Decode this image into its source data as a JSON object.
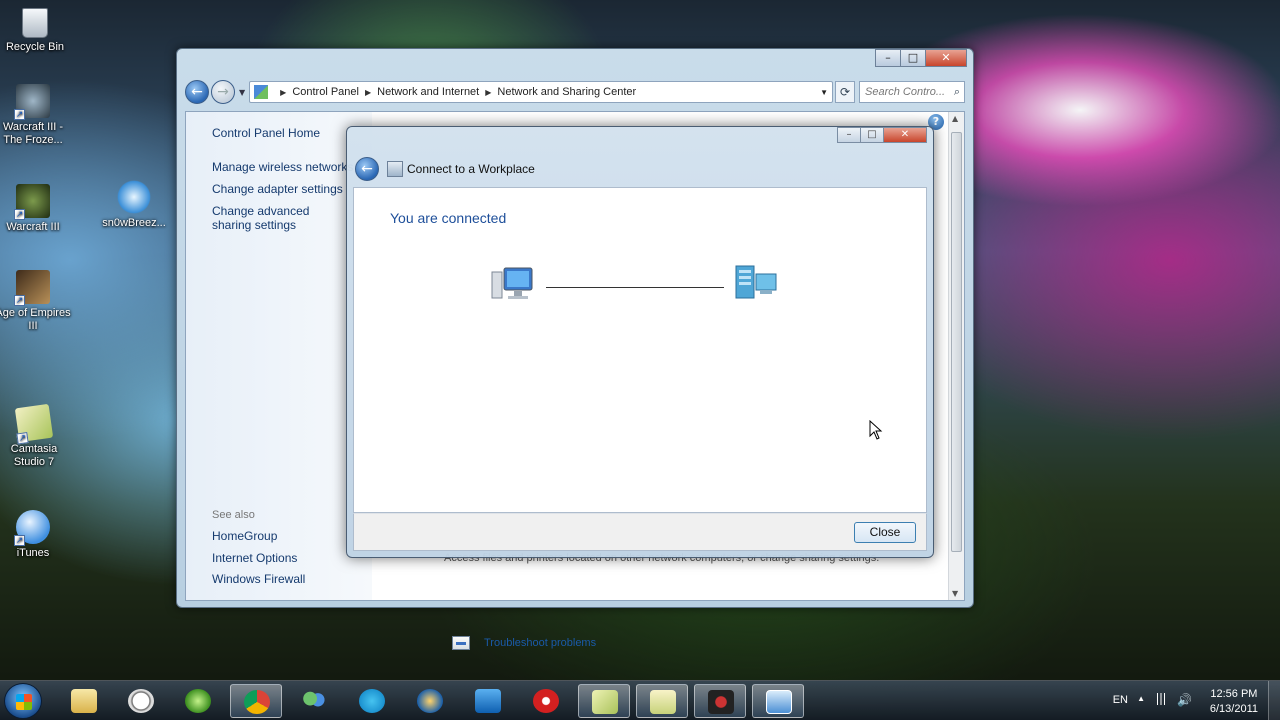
{
  "desktop": {
    "icons": [
      {
        "label": "Recycle Bin"
      },
      {
        "label": "Warcraft III - The Froze..."
      },
      {
        "label": "Warcraft III"
      },
      {
        "label": "sn0wBreez..."
      },
      {
        "label": "Age of Empires III"
      },
      {
        "label": "Camtasia Studio 7"
      },
      {
        "label": "iTunes"
      }
    ]
  },
  "main_window": {
    "breadcrumb": [
      "Control Panel",
      "Network and Internet",
      "Network and Sharing Center"
    ],
    "search_placeholder": "Search Contro...",
    "left_pane": {
      "home": "Control Panel Home",
      "links": [
        "Manage wireless networks",
        "Change adapter settings",
        "Change advanced sharing settings"
      ],
      "see_also_label": "See also",
      "see_also": [
        "HomeGroup",
        "Internet Options",
        "Windows Firewall"
      ]
    },
    "bottom_text": "Access files and printers located on other network computers, or change sharing settings.",
    "troubleshoot_link": "Troubleshoot problems"
  },
  "dialog": {
    "title": "Connect to a Workplace",
    "heading": "You are connected",
    "close_button": "Close"
  },
  "taskbar": {
    "language": "EN",
    "time": "12:56 PM",
    "date": "6/13/2011",
    "pinned": [
      "windows-explorer",
      "clock-app",
      "windows-media-player",
      "google-chrome",
      "windows-live-messenger",
      "skype",
      "avast",
      "teamviewer",
      "pokerstars",
      "notes",
      "file-manager",
      "media-app",
      "network-control-panel"
    ],
    "active": "network-control-panel"
  },
  "colors": {
    "link": "#153a6e",
    "heading": "#1e4f9a",
    "close_red": "#c8452c"
  }
}
